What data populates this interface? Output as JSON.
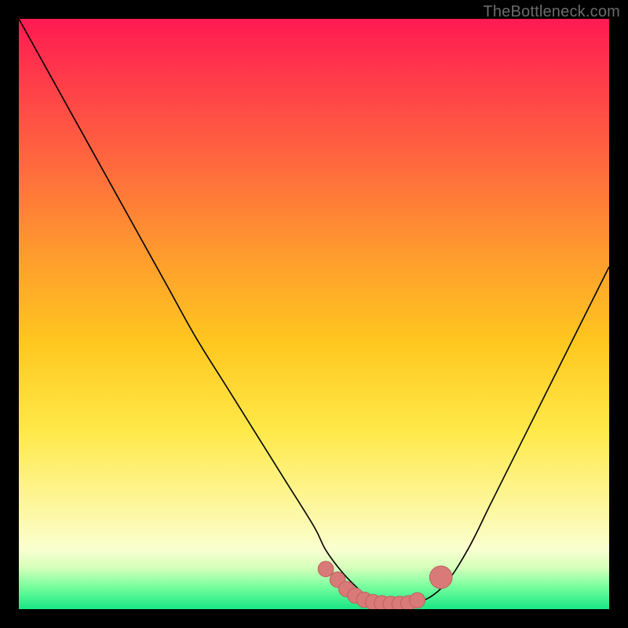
{
  "watermark": {
    "text": "TheBottleneck.com"
  },
  "colors": {
    "curve": "#000000",
    "marker_fill": "#d97a78",
    "marker_stroke": "#c06360",
    "bg_black": "#000000"
  },
  "chart_data": {
    "type": "line",
    "title": "",
    "xlabel": "",
    "ylabel": "",
    "xlim": [
      0,
      100
    ],
    "ylim": [
      0,
      100
    ],
    "grid": false,
    "legend": false,
    "series": [
      {
        "name": "bottleneck-curve",
        "x": [
          0,
          5,
          10,
          15,
          20,
          25,
          30,
          35,
          40,
          45,
          50,
          52,
          55,
          58,
          60,
          63,
          65,
          68,
          72,
          76,
          80,
          85,
          90,
          95,
          100
        ],
        "y": [
          100,
          91,
          82,
          73,
          64,
          55,
          46,
          38,
          30,
          22,
          14,
          10,
          6,
          3,
          1.5,
          0.8,
          0.8,
          1.2,
          4,
          10,
          18,
          28,
          38,
          48,
          58
        ]
      }
    ],
    "markers": [
      {
        "x": 52,
        "y": 6.8,
        "r": 1.3
      },
      {
        "x": 54,
        "y": 5.0,
        "r": 1.3
      },
      {
        "x": 55.5,
        "y": 3.4,
        "r": 1.3
      },
      {
        "x": 57,
        "y": 2.3,
        "r": 1.3
      },
      {
        "x": 58.5,
        "y": 1.6,
        "r": 1.3
      },
      {
        "x": 60,
        "y": 1.2,
        "r": 1.3
      },
      {
        "x": 61.5,
        "y": 1.0,
        "r": 1.3
      },
      {
        "x": 63,
        "y": 0.9,
        "r": 1.3
      },
      {
        "x": 64.5,
        "y": 0.9,
        "r": 1.3
      },
      {
        "x": 66,
        "y": 1.0,
        "r": 1.3
      },
      {
        "x": 67.5,
        "y": 1.5,
        "r": 1.3
      },
      {
        "x": 71.5,
        "y": 5.4,
        "r": 1.9
      }
    ]
  }
}
